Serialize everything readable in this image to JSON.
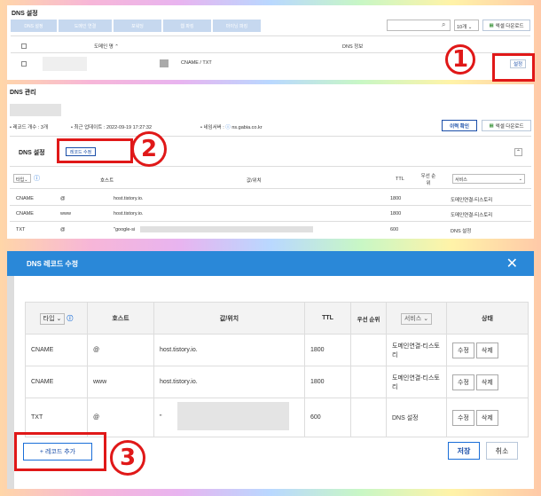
{
  "dns_settings": {
    "title": "DNS 설정",
    "toolbar": [
      "DNS 설정",
      "도메인 연결",
      "포워딩",
      "웹 파킹",
      "마이닝 파킹"
    ],
    "page_size": "10개",
    "excel": "엑셀 다운로드",
    "col_domain": "도메인 명",
    "col_info": "DNS 정보",
    "row_info": "CNAME / TXT",
    "settings_btn": "설정"
  },
  "dns_mgmt": {
    "title": "DNS 관리",
    "record_count": "레코드 개수 : 3개",
    "updated": "최근 업데이트 : 2022-09-19 17:27:32",
    "nameserver_label": "네임서버 :",
    "nameserver": "ns.gabia.co.kr",
    "history": "이력 확인",
    "excel": "엑셀 다운로드",
    "section": "DNS 설정",
    "edit_btn": "레코드 수정",
    "cols": {
      "type": "타입",
      "host": "호스트",
      "value": "값/위치",
      "ttl": "TTL",
      "priority": "우선 순위",
      "service": "서비스"
    },
    "rows": [
      {
        "type": "CNAME",
        "host": "@",
        "value": "host.tistory.io.",
        "ttl": "1800",
        "service": "도메인연결-티스토리"
      },
      {
        "type": "CNAME",
        "host": "www",
        "value": "host.tistory.io.",
        "ttl": "1800",
        "service": "도메인연결-티스토리"
      },
      {
        "type": "TXT",
        "host": "@",
        "value": "\"google-si",
        "ttl": "600",
        "service": "DNS 설정"
      }
    ]
  },
  "modal": {
    "title": "DNS 레코드 수정",
    "cols": {
      "type": "타입",
      "host": "호스트",
      "value": "값/위치",
      "ttl": "TTL",
      "priority": "우선 순위",
      "service": "서비스",
      "status": "상태"
    },
    "rows": [
      {
        "type": "CNAME",
        "host": "@",
        "value": "host.tistory.io.",
        "ttl": "1800",
        "service": "도메인연결-티스토리"
      },
      {
        "type": "CNAME",
        "host": "www",
        "value": "host.tistory.io.",
        "ttl": "1800",
        "service": "도메인연결-티스토리"
      },
      {
        "type": "TXT",
        "host": "@",
        "value": "\"",
        "ttl": "600",
        "service": "DNS 설정"
      }
    ],
    "edit": "수정",
    "delete": "삭제",
    "add": "+ 레코드 추가",
    "save": "저장",
    "cancel": "취소"
  },
  "callouts": [
    "1",
    "2",
    "3"
  ]
}
